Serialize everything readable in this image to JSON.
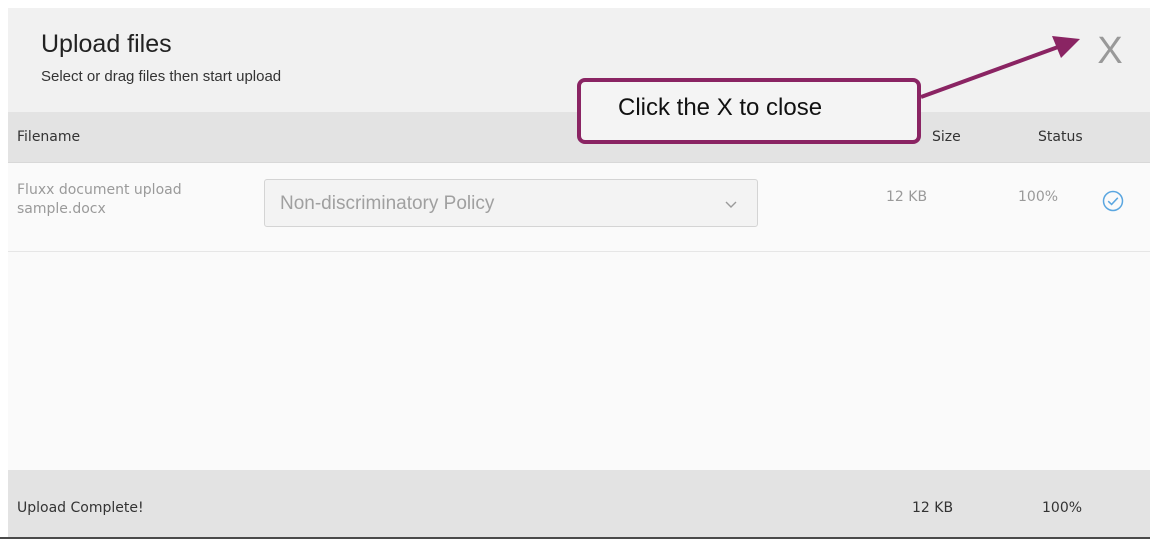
{
  "dialog": {
    "title": "Upload files",
    "subtitle": "Select or drag files then start upload",
    "close_label": "X"
  },
  "columns": {
    "filename": "Filename",
    "size": "Size",
    "status": "Status"
  },
  "files": [
    {
      "name_line1": "Fluxx document upload",
      "name_line2": "sample.docx",
      "document_type": "Non-discriminatory Policy",
      "size": "12 KB",
      "progress": "100%",
      "progress_value": 100
    }
  ],
  "footer": {
    "message": "Upload Complete!",
    "total_size": "12 KB",
    "total_progress": "100%"
  },
  "annotation": {
    "text": "Click the X to close",
    "color": "#8a2463"
  },
  "icons": {
    "dropdown": "chevron-down-icon",
    "status": "check-circle-icon"
  },
  "colors": {
    "accent": "#5aa6e0",
    "header_bg": "#e3e3e3",
    "annotation_border": "#8a2463"
  }
}
